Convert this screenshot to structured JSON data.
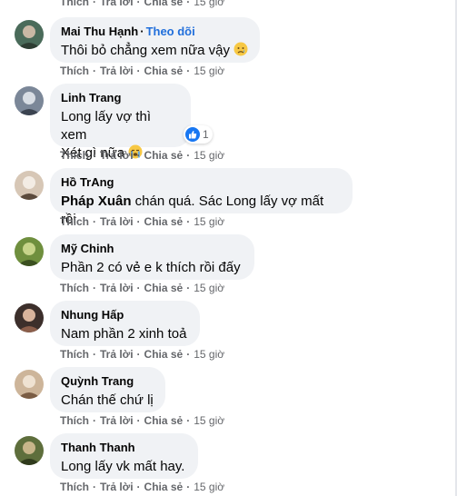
{
  "action_labels": {
    "like": "Thích",
    "reply": "Trả lời",
    "share": "Chia sẻ",
    "separator": "·"
  },
  "top_actions": {
    "time": "15 giờ"
  },
  "comments": [
    {
      "author": "Mai Thu Hạnh",
      "follow_label": "Theo dõi",
      "lines": [
        "Thôi bỏ chẳng xem nữa vậy"
      ],
      "emoji": "crying-face",
      "time": "15 giờ",
      "avatar_colors": [
        "#4a6b5a",
        "#c9b8a5",
        "#2e3d33"
      ]
    },
    {
      "author": "Linh Trang",
      "lines": [
        "Long lấy vợ thì xem",
        "Xét gì nữa"
      ],
      "emoji": "loudly-crying-face",
      "reaction": {
        "icon": "like",
        "count": "1"
      },
      "time": "15 giờ",
      "avatar_colors": [
        "#7b8798",
        "#d8dde4",
        "#3b4350"
      ]
    },
    {
      "author": "Hồ TrAng",
      "mention": "Pháp Xuân",
      "lines": [
        " chán quá. Sác Long lấy vợ mất rồi"
      ],
      "time": "15 giờ",
      "avatar_colors": [
        "#d7c7b6",
        "#f3ece4",
        "#5b4a3c"
      ]
    },
    {
      "author": "Mỹ Chinh",
      "lines": [
        "Phần 2 có vẻ e k thích rồi đấy"
      ],
      "time": "15 giờ",
      "avatar_colors": [
        "#6f8f3e",
        "#c7d48a",
        "#3b5020"
      ]
    },
    {
      "author": "Nhung Hấp",
      "lines": [
        "Nam phần 2 xinh toả"
      ],
      "time": "15 giờ",
      "avatar_colors": [
        "#3c2f2b",
        "#d9b49c",
        "#8b5e4b"
      ]
    },
    {
      "author": "Quỳnh Trang",
      "lines": [
        "Chán thế chứ lị"
      ],
      "time": "15 giờ",
      "avatar_colors": [
        "#cdb59a",
        "#efe2d2",
        "#7a5c44"
      ]
    },
    {
      "author": "Thanh Thanh",
      "lines": [
        "Long lấy vk mất hay."
      ],
      "time": "15 giờ",
      "avatar_colors": [
        "#5e6e3c",
        "#c8b58a",
        "#2f3a1c"
      ]
    }
  ]
}
